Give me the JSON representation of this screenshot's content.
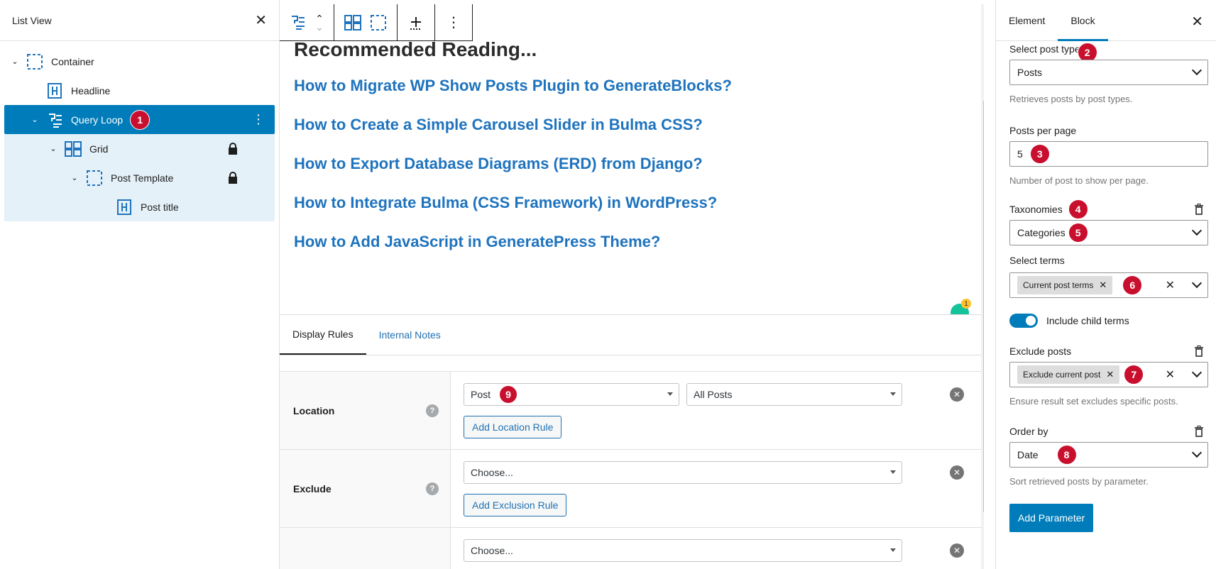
{
  "list_view": {
    "title": "List View",
    "items": [
      {
        "label": "Container",
        "icon": "container-icon"
      },
      {
        "label": "Headline",
        "icon": "headline-icon"
      },
      {
        "label": "Query Loop",
        "icon": "query-loop-icon",
        "badge": "1"
      },
      {
        "label": "Grid",
        "icon": "grid-icon"
      },
      {
        "label": "Post Template",
        "icon": "container-icon"
      },
      {
        "label": "Post title",
        "icon": "headline-icon"
      }
    ]
  },
  "editor": {
    "heading": "Recommended Reading...",
    "posts": [
      "How to Migrate WP Show Posts Plugin to GenerateBlocks?",
      "How to Create a Simple Carousel Slider in Bulma CSS?",
      "How to Export Database Diagrams (ERD) from Django?",
      "How to Integrate Bulma (CSS Framework) in WordPress?",
      "How to Add JavaScript in GeneratePress Theme?"
    ],
    "grammarly_count": "1"
  },
  "meta_box": {
    "tabs": [
      "Display Rules",
      "Internal Notes"
    ],
    "rules": [
      {
        "label": "Location",
        "select1": "Post",
        "select2": "All Posts",
        "badge": "9",
        "button": "Add Location Rule"
      },
      {
        "label": "Exclude",
        "select1": "Choose...",
        "button": "Add Exclusion Rule"
      },
      {
        "label": "",
        "select1": "Choose..."
      }
    ],
    "help_glyph": "?"
  },
  "sidebar": {
    "tabs": [
      "Element",
      "Block"
    ],
    "post_type": {
      "label": "Select post type",
      "badge": "2",
      "value": "Posts",
      "help": "Retrieves posts by post types."
    },
    "per_page": {
      "label": "Posts per page",
      "badge": "3",
      "value": "5",
      "help": "Number of post to show per page."
    },
    "taxonomies": {
      "label": "Taxonomies",
      "badge": "4",
      "value": "Categories",
      "value_badge": "5"
    },
    "select_terms": {
      "label": "Select terms",
      "token": "Current post terms",
      "badge": "6"
    },
    "include_child": {
      "label": "Include child terms"
    },
    "exclude_posts": {
      "label": "Exclude posts",
      "token": "Exclude current post",
      "badge": "7",
      "help": "Ensure result set excludes specific posts."
    },
    "order_by": {
      "label": "Order by",
      "value": "Date",
      "badge": "8",
      "help": "Sort retrieved posts by parameter."
    },
    "add_parameter": "Add Parameter"
  },
  "colors": {
    "accent": "#007cba",
    "link": "#1e73be",
    "badge": "#c8102e"
  }
}
